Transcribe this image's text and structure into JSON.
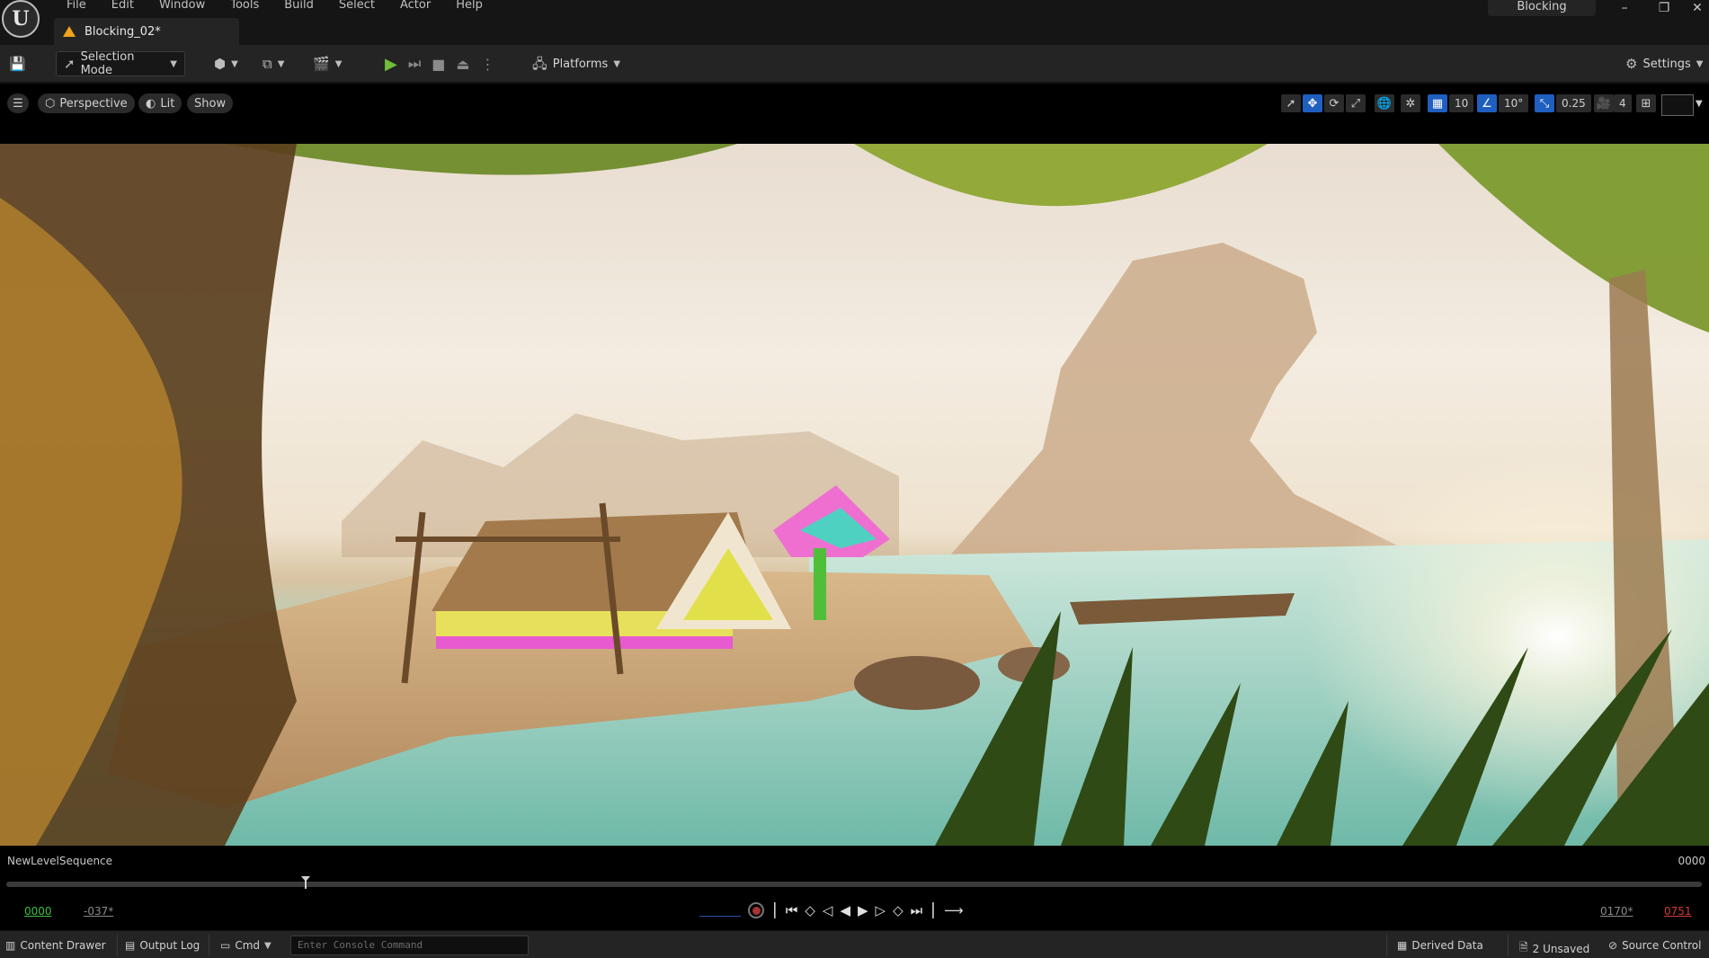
{
  "menu": [
    "File",
    "Edit",
    "Window",
    "Tools",
    "Build",
    "Select",
    "Actor",
    "Help"
  ],
  "document_tab": {
    "label": "Blocking_02*"
  },
  "layout_tab": {
    "label": "Blocking"
  },
  "toolbar": {
    "selection_mode": "Selection Mode",
    "platforms": "Platforms",
    "settings": "Settings"
  },
  "viewport_toolbar": {
    "perspective": "Perspective",
    "lit": "Lit",
    "show": "Show",
    "grid_snap": "10",
    "rotation_snap": "10°",
    "scale_snap": "0.25",
    "camera_speed": "4"
  },
  "sequencer": {
    "name": "NewLevelSequence",
    "end_label": "0000",
    "current_frame": "0000",
    "start_frame": "-037*",
    "end_frame_in": "0170*",
    "end_frame_out": "0751",
    "colors": {
      "current": "#3fbf3f",
      "out": "#d23a3a"
    }
  },
  "status_bar": {
    "content_drawer": "Content Drawer",
    "output_log": "Output Log",
    "cmd": "Cmd",
    "console_placeholder": "Enter Console Command",
    "derived_data": "Derived Data",
    "unsaved": "2 Unsaved",
    "source_control": "Source Control"
  }
}
